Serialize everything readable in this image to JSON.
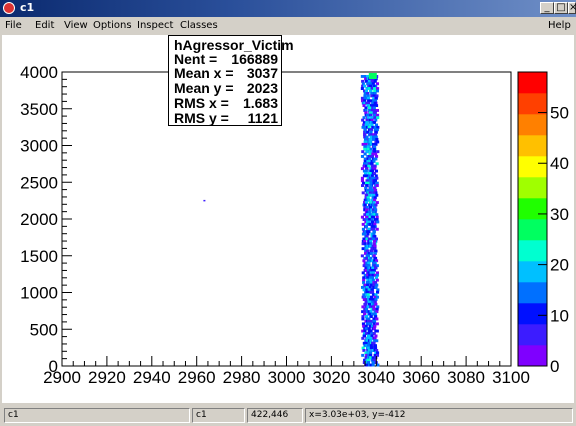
{
  "window": {
    "title": "c1"
  },
  "winbuttons": {
    "minimize": "_",
    "maximize": "□",
    "close": "×"
  },
  "menu": {
    "file": "File",
    "edit": "Edit",
    "view": "View",
    "options": "Options",
    "inspect": "Inspect",
    "classes": "Classes",
    "help": "Help"
  },
  "stats": {
    "name": "hAgressor_Victim",
    "rows": [
      {
        "label": "Nent = ",
        "value": "166889"
      },
      {
        "label": "Mean x = ",
        "value": "3037"
      },
      {
        "label": "Mean y = ",
        "value": "2023"
      },
      {
        "label": "RMS x = ",
        "value": "1.683"
      },
      {
        "label": "RMS y = ",
        "value": "1121"
      }
    ]
  },
  "chart_data": {
    "type": "heatmap",
    "title": "",
    "xlabel": "",
    "ylabel": "",
    "xlim": [
      2900,
      3100
    ],
    "ylim": [
      0,
      4000
    ],
    "x_ticks": [
      "2900",
      "2920",
      "2940",
      "2960",
      "2980",
      "3000",
      "3020",
      "3040",
      "3060",
      "3080",
      "3100"
    ],
    "y_ticks": [
      "0",
      "500",
      "1000",
      "1500",
      "2000",
      "2500",
      "3000",
      "3500",
      "4000"
    ],
    "z_ticks": [
      "0",
      "10",
      "20",
      "30",
      "40",
      "50"
    ],
    "band_x_center": 3037,
    "band_x_range": [
      3034,
      3040
    ],
    "isolated_point": {
      "x": 2963,
      "y": 2260
    },
    "palette": [
      "#7f00ff",
      "#3c1cff",
      "#0010ff",
      "#0070ff",
      "#00c0ff",
      "#00ffd0",
      "#00ff60",
      "#20ff00",
      "#a0ff00",
      "#ffff00",
      "#ffc000",
      "#ff8000",
      "#ff4000",
      "#ff0000"
    ]
  },
  "status": {
    "field1": "c1",
    "field2": "c1",
    "field3": "422,446",
    "field4": "x=3.03e+03, y=-412"
  }
}
